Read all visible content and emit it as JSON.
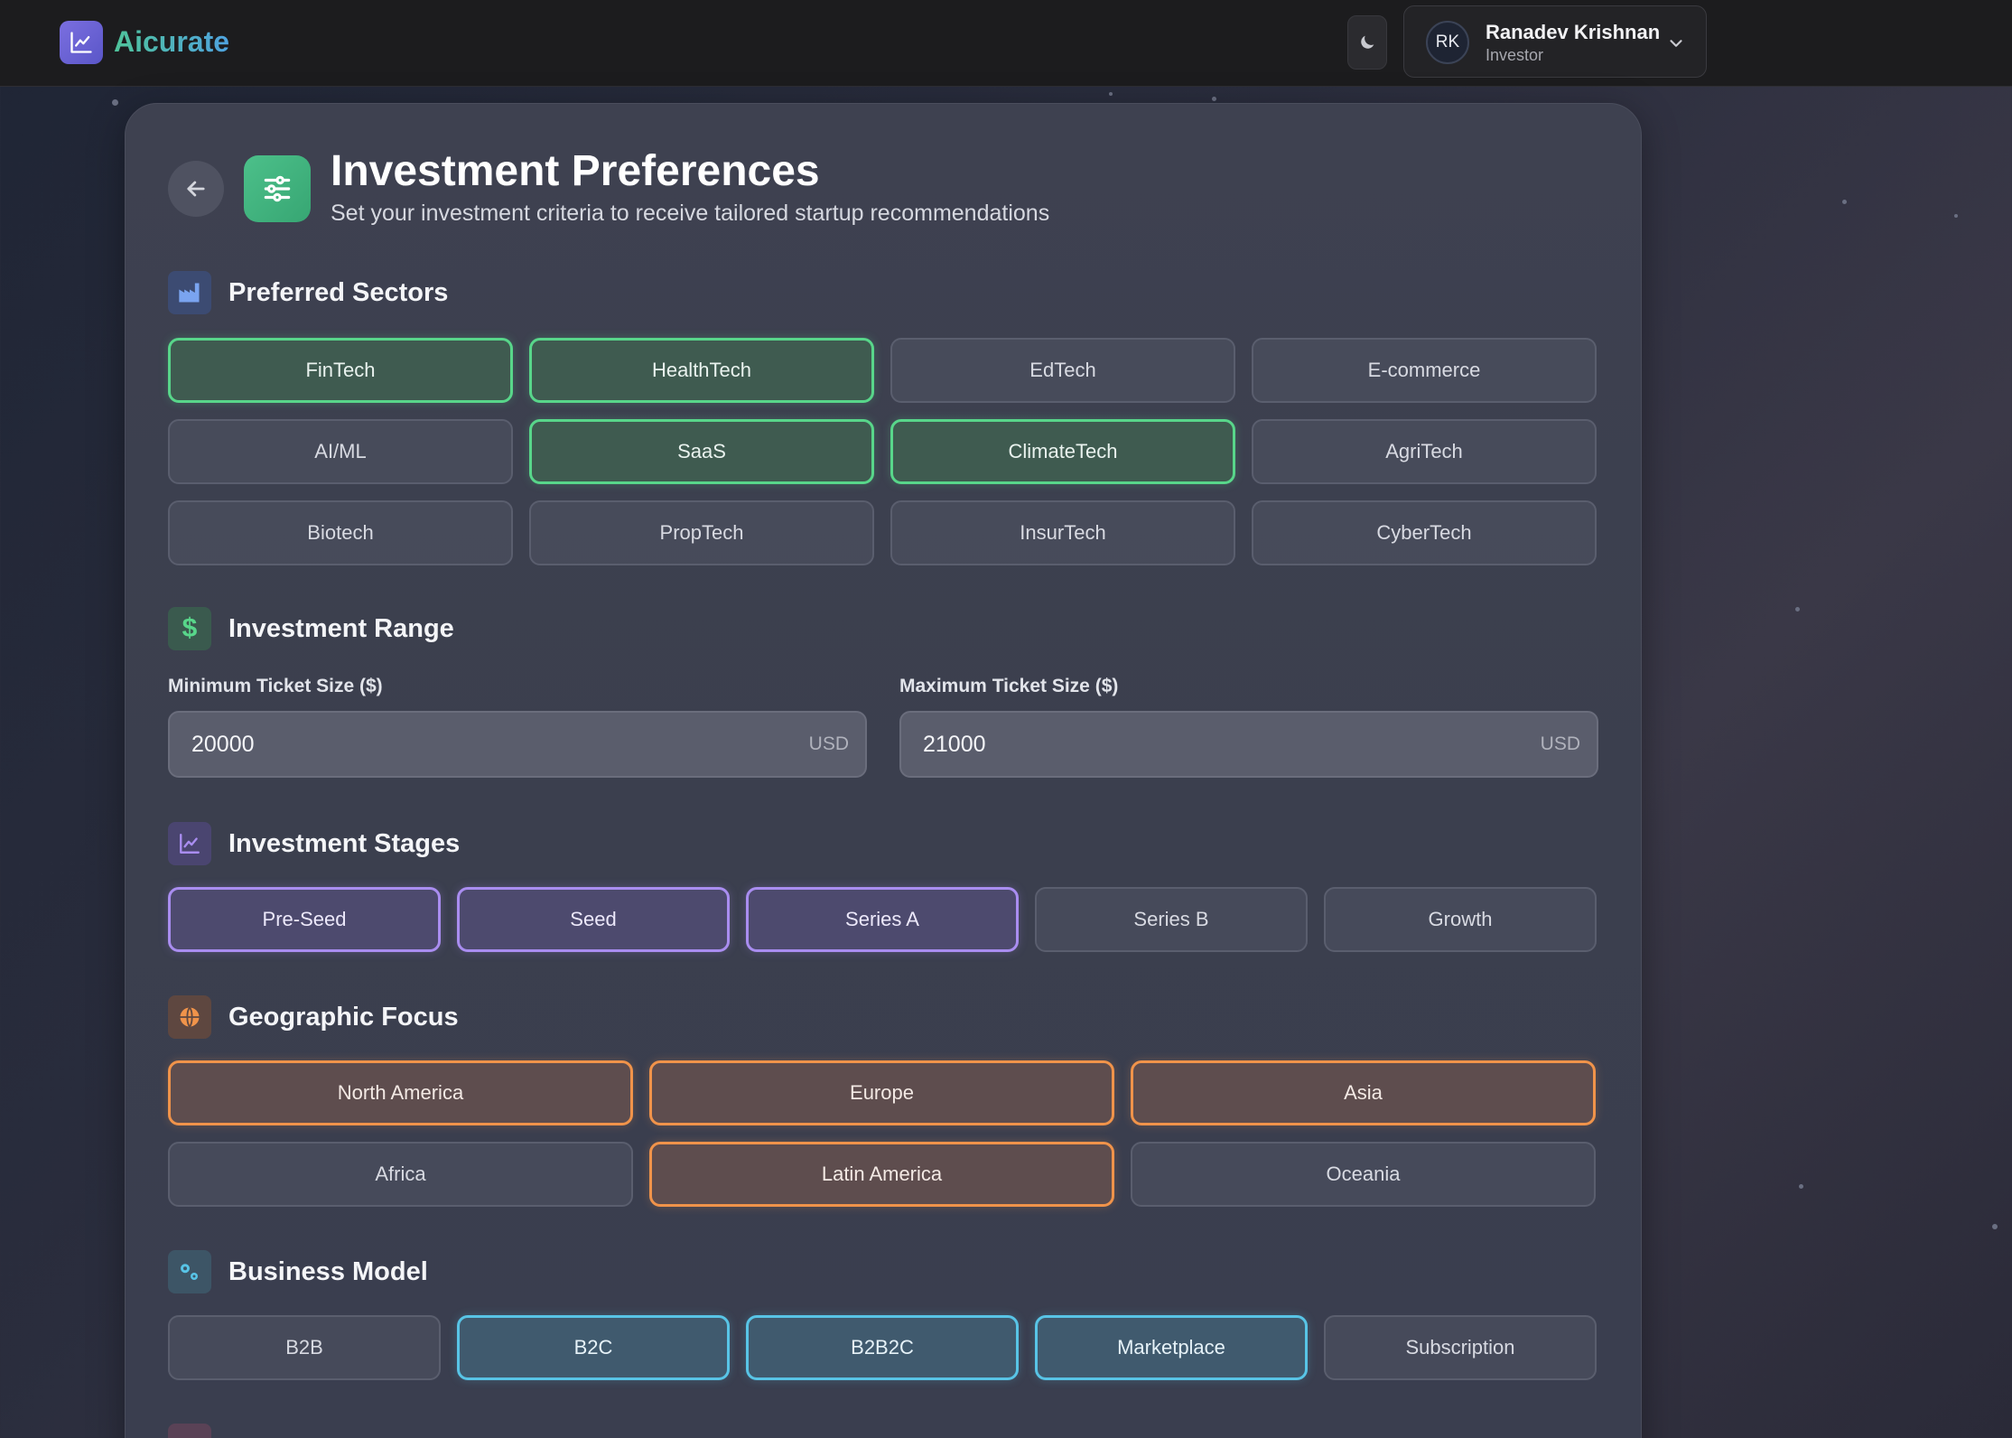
{
  "app": {
    "name": "Aicurate"
  },
  "user": {
    "initials": "RK",
    "name": "Ranadev Krishnan",
    "role": "Investor"
  },
  "page": {
    "title": "Investment Preferences",
    "subtitle": "Set your investment criteria to receive tailored startup recommendations"
  },
  "sectors": {
    "title": "Preferred Sectors",
    "items": [
      {
        "label": "FinTech",
        "selected": true
      },
      {
        "label": "HealthTech",
        "selected": true
      },
      {
        "label": "EdTech",
        "selected": false
      },
      {
        "label": "E-commerce",
        "selected": false
      },
      {
        "label": "AI/ML",
        "selected": false
      },
      {
        "label": "SaaS",
        "selected": true
      },
      {
        "label": "ClimateTech",
        "selected": true
      },
      {
        "label": "AgriTech",
        "selected": false
      },
      {
        "label": "Biotech",
        "selected": false
      },
      {
        "label": "PropTech",
        "selected": false
      },
      {
        "label": "InsurTech",
        "selected": false
      },
      {
        "label": "CyberTech",
        "selected": false
      }
    ]
  },
  "range": {
    "title": "Investment Range",
    "min_label": "Minimum Ticket Size ($)",
    "min_value": "20000",
    "max_label": "Maximum Ticket Size ($)",
    "max_value": "21000",
    "unit": "USD"
  },
  "stages": {
    "title": "Investment Stages",
    "items": [
      {
        "label": "Pre-Seed",
        "selected": true
      },
      {
        "label": "Seed",
        "selected": true
      },
      {
        "label": "Series A",
        "selected": true
      },
      {
        "label": "Series B",
        "selected": false
      },
      {
        "label": "Growth",
        "selected": false
      }
    ]
  },
  "geo": {
    "title": "Geographic Focus",
    "items": [
      {
        "label": "North America",
        "selected": true
      },
      {
        "label": "Europe",
        "selected": true
      },
      {
        "label": "Asia",
        "selected": true
      },
      {
        "label": "Africa",
        "selected": false
      },
      {
        "label": "Latin America",
        "selected": true
      },
      {
        "label": "Oceania",
        "selected": false
      }
    ]
  },
  "business": {
    "title": "Business Model",
    "items": [
      {
        "label": "B2B",
        "selected": false
      },
      {
        "label": "B2C",
        "selected": true
      },
      {
        "label": "B2B2C",
        "selected": true
      },
      {
        "label": "Marketplace",
        "selected": true
      },
      {
        "label": "Subscription",
        "selected": false
      }
    ]
  },
  "colors": {
    "sectors": "#58d68a",
    "stages": "#a98df0",
    "geo": "#f0934a",
    "business": "#58c4e6"
  },
  "icons": {
    "logo": "chart-line-icon",
    "theme": "moon-icon",
    "back": "arrow-left-icon",
    "preferences": "sliders-icon",
    "sectors": "industry-icon",
    "range": "dollar-icon",
    "stages": "chart-line-icon",
    "geo": "globe-icon",
    "business": "gears-icon"
  }
}
